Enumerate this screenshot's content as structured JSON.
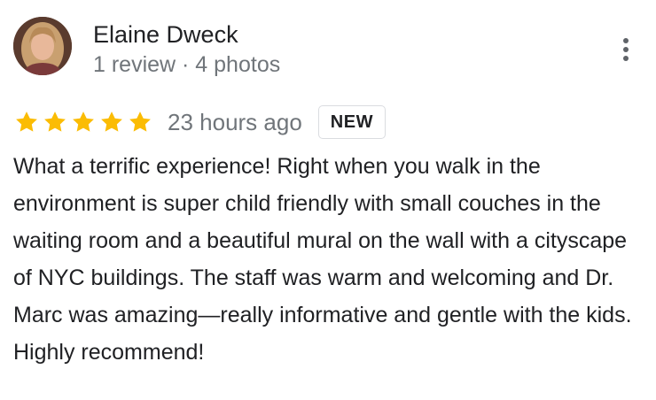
{
  "review": {
    "author": {
      "name": "Elaine Dweck",
      "meta": "1 review · 4 photos",
      "avatar_icon": "profile-photo"
    },
    "menu_icon": "more-vert-icon",
    "rating": {
      "stars": 5,
      "max_stars": 5,
      "star_color": "#fbbc04",
      "time": "23 hours ago",
      "badge": "NEW"
    },
    "text": "What a terrific experience! Right when you walk in the environment is super child friendly with small couches in the waiting room and a beautiful mural on the wall with a cityscape of NYC buildings. The staff was warm and welcoming and Dr. Marc was amazing—really informative and gentle with the kids. Highly recommend!"
  }
}
